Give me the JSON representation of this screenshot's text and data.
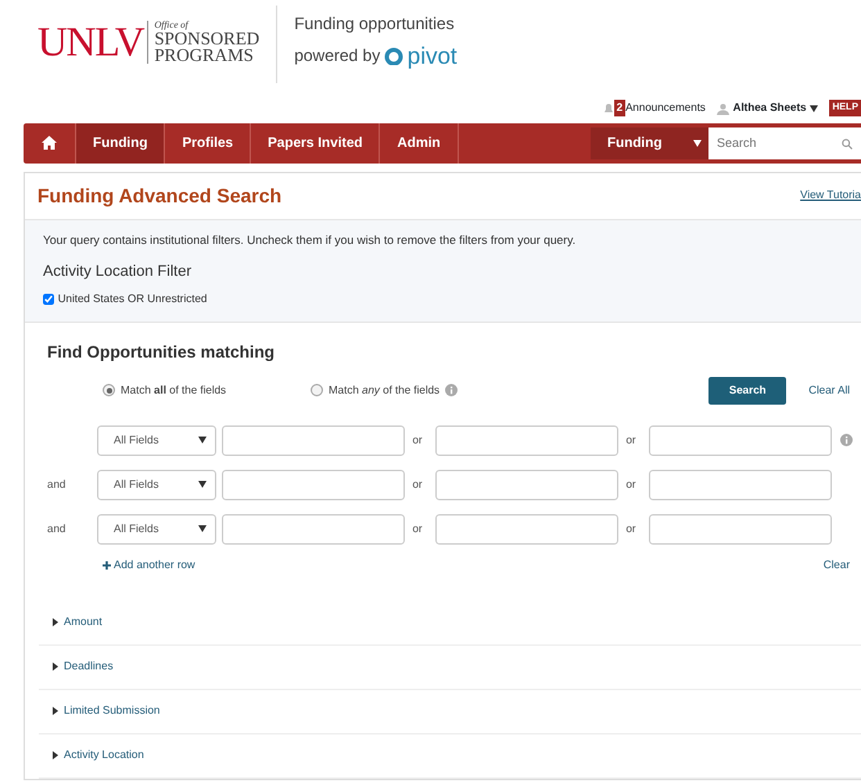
{
  "header": {
    "logo_word": "UNLV",
    "logo_small": "Office of",
    "logo_line1": "SPONSORED",
    "logo_line2": "PROGRAMS",
    "tagline": "Funding opportunities",
    "powered_by": "powered by",
    "pivot": "pivot"
  },
  "user_bar": {
    "badge": "2",
    "announcements": "Announcements",
    "user": "Althea Sheets",
    "help": "HELP"
  },
  "nav": {
    "items": [
      {
        "label": "Funding",
        "selected": true
      },
      {
        "label": "Profiles",
        "selected": false
      },
      {
        "label": "Papers Invited",
        "selected": false
      },
      {
        "label": "Admin",
        "selected": false
      }
    ],
    "scope": "Funding",
    "search_placeholder": "Search"
  },
  "panel": {
    "title": "Funding Advanced Search",
    "tutorial": "View Tutoria",
    "notice": "Your query contains institutional filters. Uncheck them if you wish to remove the filters from your query.",
    "filter_title": "Activity Location Filter",
    "filters": [
      {
        "label": "United States OR Unrestricted",
        "checked": true
      }
    ]
  },
  "search": {
    "title": "Find Opportunities matching",
    "modes": [
      {
        "label": "Match **all** of the fields",
        "selected": true
      },
      {
        "label": "Match *any* of the fields",
        "selected": false
      }
    ],
    "search_button": "Search",
    "clear_all": "Clear All",
    "rows": [
      {
        "connector": null,
        "field": "All Fields",
        "or1": "or",
        "or2": "or"
      },
      {
        "connector": "and",
        "field": "All Fields",
        "or1": "or",
        "or2": "or"
      },
      {
        "connector": "and",
        "field": "All Fields",
        "or1": "or",
        "or2": "or"
      }
    ],
    "add_row": "Add another row",
    "clear": "Clear"
  },
  "sections": [
    {
      "label": "Amount",
      "expanded": false
    },
    {
      "label": "Deadlines",
      "expanded": false
    },
    {
      "label": "Limited Submission",
      "expanded": false
    },
    {
      "label": "Activity Location",
      "expanded": false
    }
  ]
}
